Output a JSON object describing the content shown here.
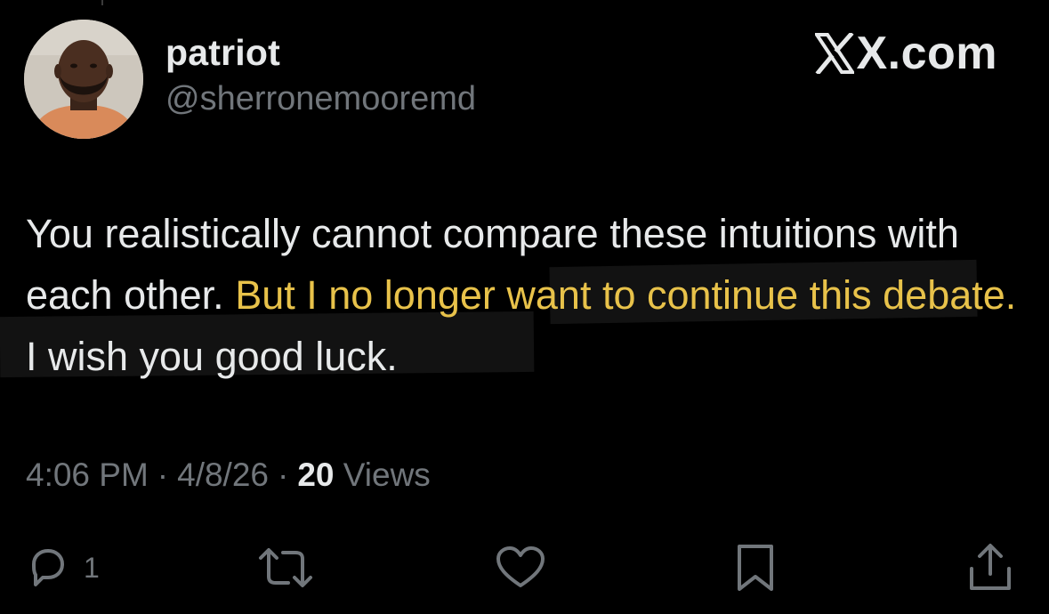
{
  "author": {
    "display_name": "patriot",
    "handle": "@sherronemooremd",
    "avatar_icon": "avatar-photo"
  },
  "brand": {
    "label": "X.com",
    "icon": "x-logo-icon"
  },
  "tweet": {
    "text_plain_1": "You realistically cannot compare these intuitions with each other. ",
    "text_highlighted": "But I no longer want to continue this debate.",
    "text_plain_2": " I wish you good luck.",
    "highlight_color": "#e8c24a"
  },
  "meta": {
    "time": "4:06 PM",
    "separator": "·",
    "date": "4/8/26",
    "views_count": "20",
    "views_label": "Views"
  },
  "actions": {
    "reply_count": "1",
    "reply_icon": "reply-icon",
    "repost_icon": "repost-icon",
    "like_icon": "heart-icon",
    "bookmark_icon": "bookmark-icon",
    "share_icon": "share-icon"
  },
  "colors": {
    "background": "#000000",
    "text_primary": "#e7e9ea",
    "text_secondary": "#71767b"
  }
}
